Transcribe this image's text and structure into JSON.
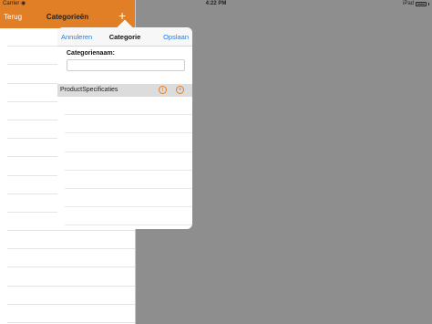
{
  "status_bar": {
    "carrier": "Carrier",
    "time": "4:22 PM",
    "device": "iPad"
  },
  "master": {
    "back_label": "Terug",
    "title": "Categorieën",
    "add_symbol": "+",
    "row_count": 16
  },
  "popover": {
    "cancel_label": "Annuleren",
    "title": "Categorie",
    "save_label": "Opslaan",
    "name_label": "Categorienaam:",
    "name_value": "",
    "section_label": "ProductSpecificaties",
    "info_symbol": "i",
    "add_symbol": "+",
    "row_count": 7
  },
  "colors": {
    "accent": "#e07f26",
    "link": "#1a7ef5",
    "detail_background": "#8e8e8e",
    "section_background": "#dcdcdc"
  },
  "icons": [
    "wifi-icon",
    "battery-icon",
    "add-icon",
    "info-icon",
    "add-spec-icon"
  ]
}
